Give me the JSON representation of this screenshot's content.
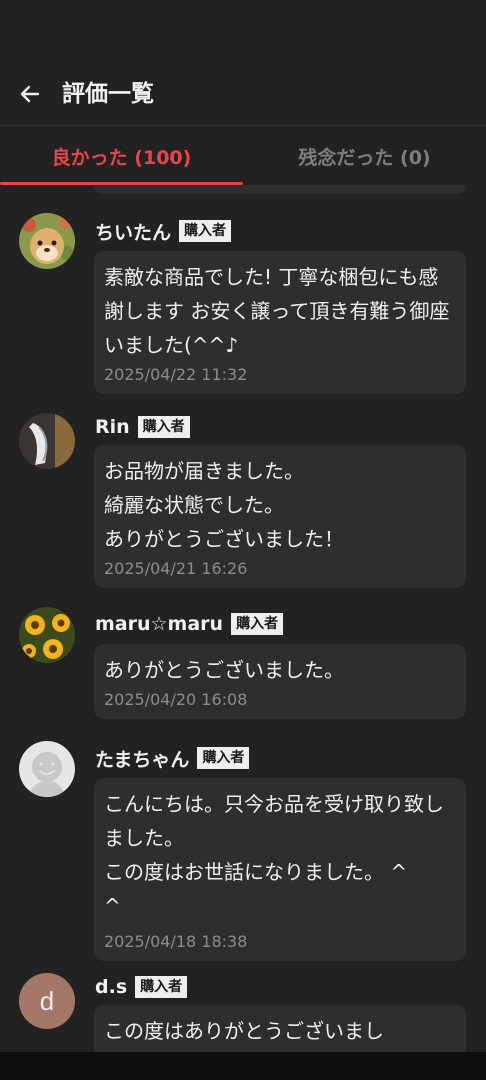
{
  "header": {
    "title": "評価一覧",
    "back_icon": "arrow-left-icon"
  },
  "tabs": [
    {
      "label": "良かった (100)",
      "active": true
    },
    {
      "label": "残念だった (0)",
      "active": false
    }
  ],
  "colors": {
    "accent": "#e8454a",
    "background": "#222222",
    "bubble": "#2e2e2e"
  },
  "reviews": [
    {
      "name": "ちいたん",
      "badge": "購入者",
      "comment": "素敵な商品でした! 丁寧な梱包にも感謝します お安く譲って頂き有難う御座いました(^^♪",
      "date": "2025/04/22 11:32"
    },
    {
      "name": "Rin",
      "badge": "購入者",
      "comment": "お品物が届きました。\n綺麗な状態でした。\nありがとうございました！",
      "date": "2025/04/21 16:26"
    },
    {
      "name": "maru☆maru",
      "badge": "購入者",
      "comment": "ありがとうございました。",
      "date": "2025/04/20 16:08"
    },
    {
      "name": "たまちゃん",
      "badge": "購入者",
      "comment": "こんにちは。只今お品を受け取り致しました。\nこの度はお世話になりました。 ^\n^",
      "date": "2025/04/18 18:38"
    },
    {
      "name": "d.s",
      "badge": "購入者",
      "avatar_letter": "d",
      "comment": "この度はありがとうございまし"
    }
  ]
}
